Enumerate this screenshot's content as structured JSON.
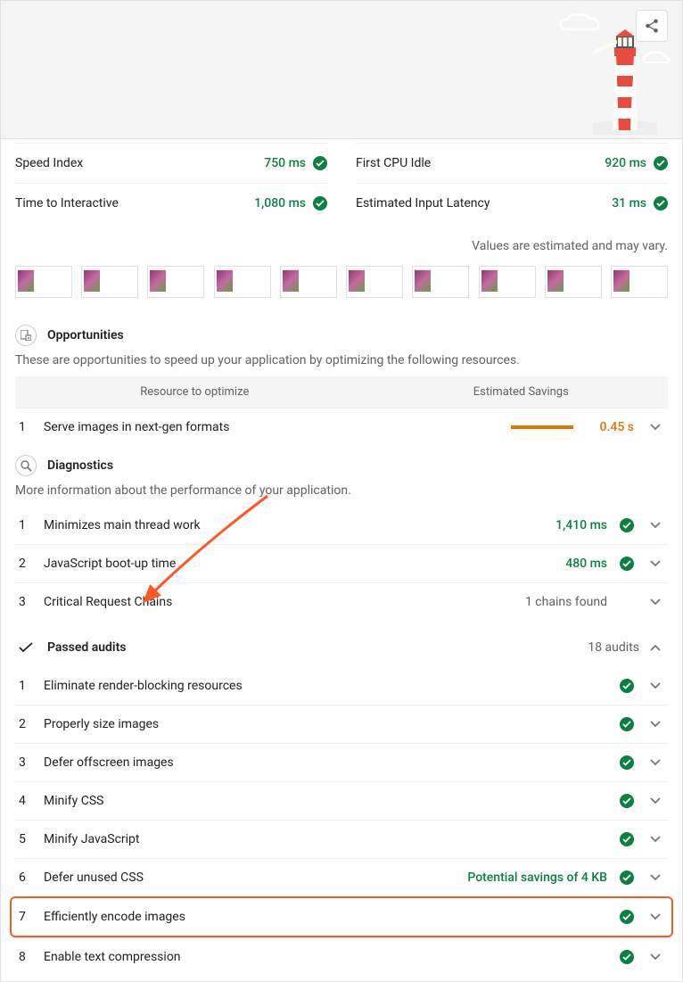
{
  "metrics": {
    "left": [
      {
        "label": "Speed Index",
        "value": "750 ms"
      },
      {
        "label": "Time to Interactive",
        "value": "1,080 ms"
      }
    ],
    "right": [
      {
        "label": "First CPU Idle",
        "value": "920 ms"
      },
      {
        "label": "Estimated Input Latency",
        "value": "31 ms"
      }
    ]
  },
  "estimated_note": "Values are estimated and may vary.",
  "opportunities": {
    "title": "Opportunities",
    "desc": "These are opportunities to speed up your application by optimizing the following resources.",
    "col1": "Resource to optimize",
    "col2": "Estimated Savings",
    "items": [
      {
        "num": "1",
        "label": "Serve images in next-gen formats",
        "value": "0.45 s"
      }
    ]
  },
  "diagnostics": {
    "title": "Diagnostics",
    "desc": "More information about the performance of your application.",
    "items": [
      {
        "num": "1",
        "label": "Minimizes main thread work",
        "value": "1,410 ms",
        "pass": true
      },
      {
        "num": "2",
        "label": "JavaScript boot-up time",
        "value": "480 ms",
        "pass": true
      },
      {
        "num": "3",
        "label": "Critical Request Chains",
        "value": "1 chains found",
        "secondary": true
      }
    ]
  },
  "passed": {
    "title": "Passed audits",
    "count": "18 audits",
    "items": [
      {
        "num": "1",
        "label": "Eliminate render-blocking resources",
        "value": ""
      },
      {
        "num": "2",
        "label": "Properly size images",
        "value": ""
      },
      {
        "num": "3",
        "label": "Defer offscreen images",
        "value": ""
      },
      {
        "num": "4",
        "label": "Minify CSS",
        "value": ""
      },
      {
        "num": "5",
        "label": "Minify JavaScript",
        "value": ""
      },
      {
        "num": "6",
        "label": "Defer unused CSS",
        "value": "Potential savings of 4 KB"
      },
      {
        "num": "7",
        "label": "Efficiently encode images",
        "value": "",
        "highlight": true
      },
      {
        "num": "8",
        "label": "Enable text compression",
        "value": ""
      }
    ]
  }
}
